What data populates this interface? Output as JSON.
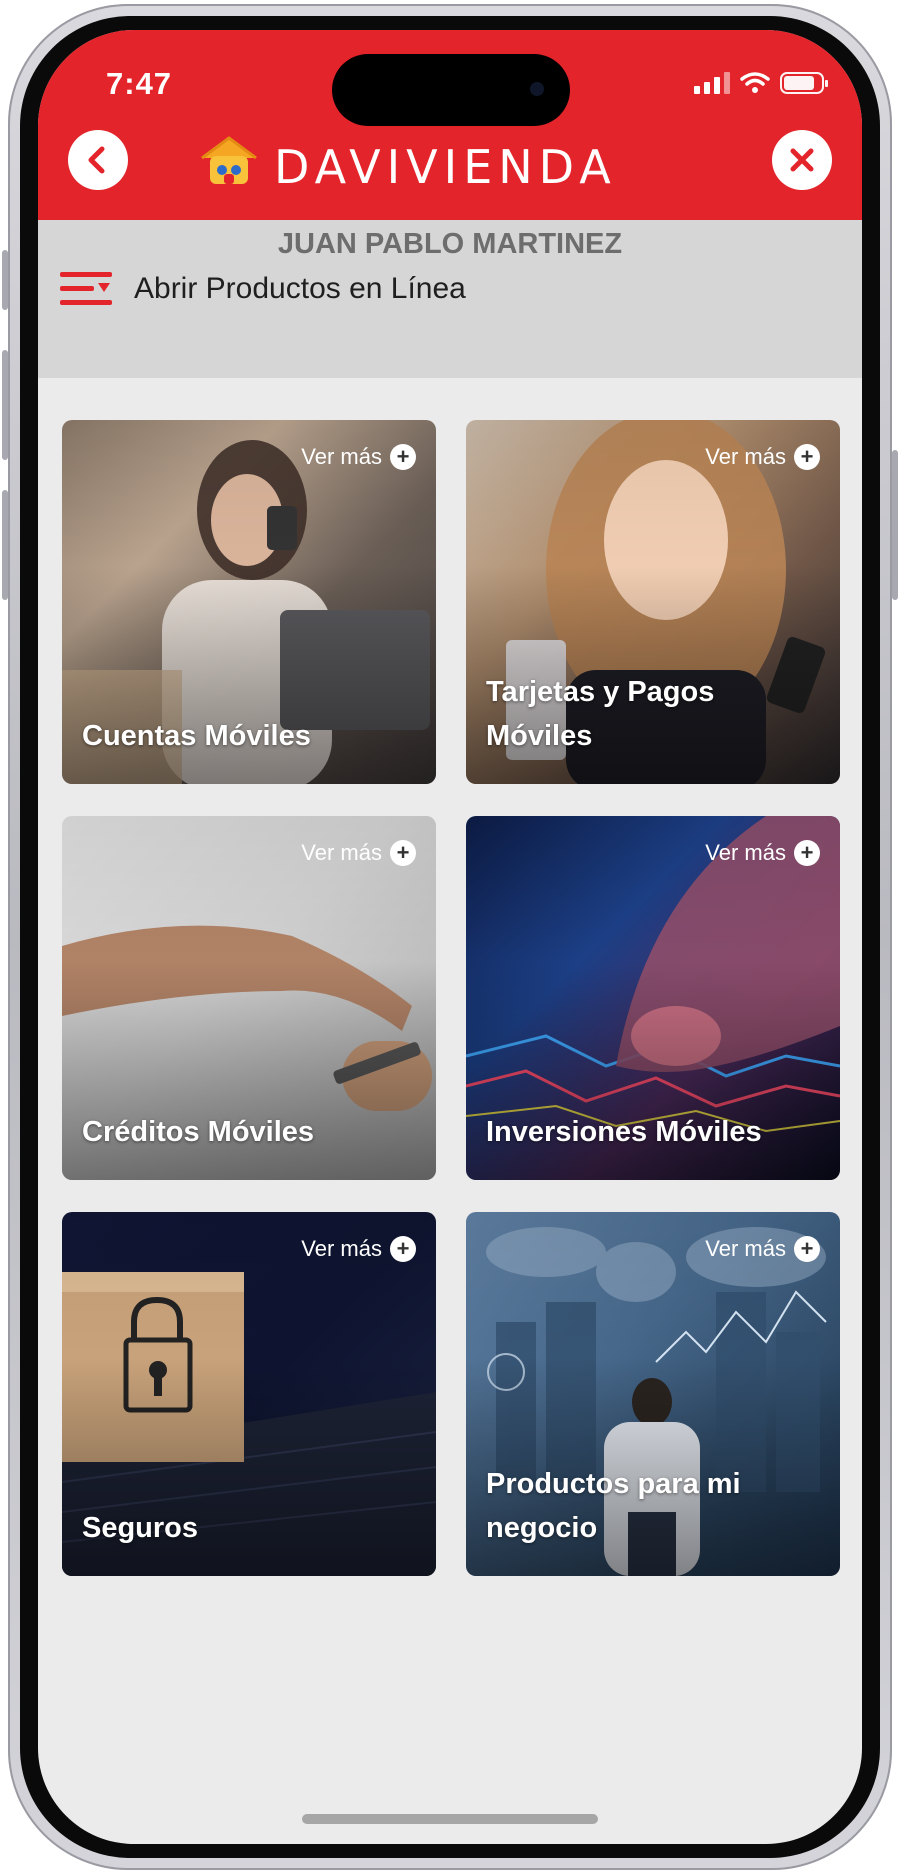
{
  "status_bar": {
    "time": "7:47"
  },
  "header": {
    "brand": "DAVIVIENDA",
    "back_icon": "chevron-left-icon",
    "close_icon": "close-icon",
    "brand_color": "#e3242b"
  },
  "user": {
    "name": "JUAN PABLO MARTINEZ",
    "menu_label": "Abrir Productos en Línea",
    "menu_icon": "menu-lines-icon"
  },
  "cards": [
    {
      "title": "Cuentas Móviles",
      "more": "Ver más"
    },
    {
      "title": "Tarjetas y Pagos Móviles",
      "more": "Ver más"
    },
    {
      "title": "Créditos Móviles",
      "more": "Ver más"
    },
    {
      "title": "Inversiones Móviles",
      "more": "Ver más"
    },
    {
      "title": "Seguros",
      "more": "Ver más"
    },
    {
      "title": "Productos para mi negocio",
      "more": "Ver más"
    }
  ]
}
